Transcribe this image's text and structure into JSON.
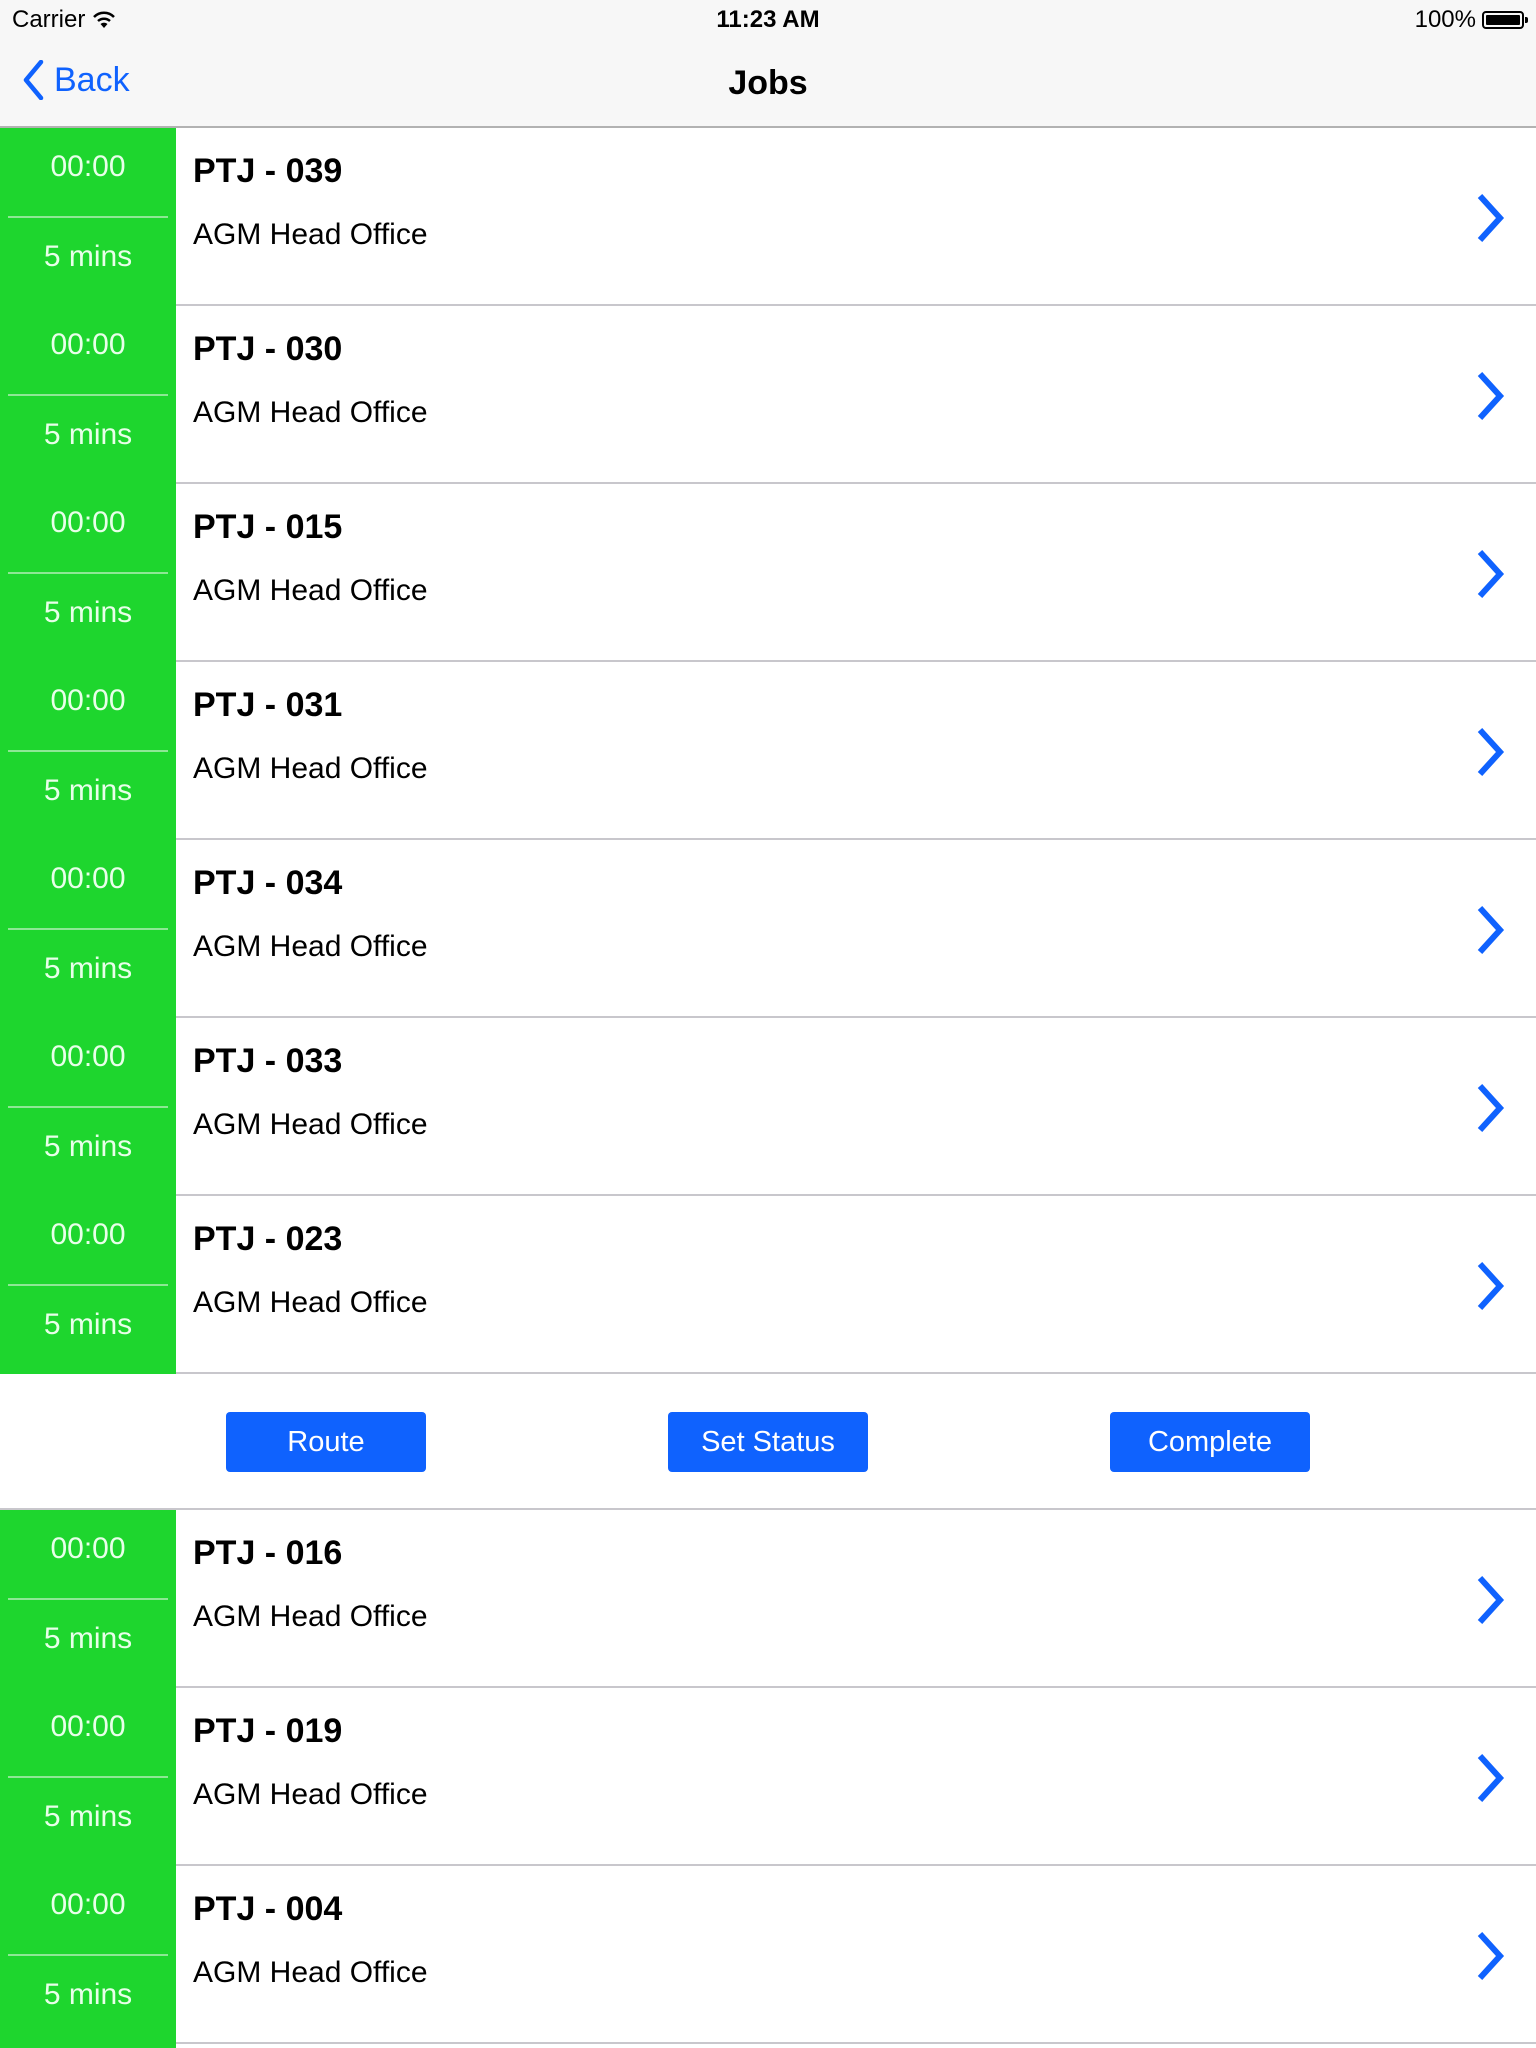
{
  "status_bar": {
    "carrier": "Carrier",
    "time": "11:23 AM",
    "battery": "100%",
    "battery_level": 1.0
  },
  "nav": {
    "back_label": "Back",
    "title": "Jobs"
  },
  "colors": {
    "accent": "#0f62fe",
    "status_green": "#1ed62e"
  },
  "jobs_top": [
    {
      "time": "00:00",
      "duration": "5 mins",
      "code": "PTJ - 039",
      "location": "AGM Head Office"
    },
    {
      "time": "00:00",
      "duration": "5 mins",
      "code": "PTJ - 030",
      "location": "AGM Head Office"
    },
    {
      "time": "00:00",
      "duration": "5 mins",
      "code": "PTJ - 015",
      "location": "AGM Head Office"
    },
    {
      "time": "00:00",
      "duration": "5 mins",
      "code": "PTJ - 031",
      "location": "AGM Head Office"
    },
    {
      "time": "00:00",
      "duration": "5 mins",
      "code": "PTJ - 034",
      "location": "AGM Head Office"
    },
    {
      "time": "00:00",
      "duration": "5 mins",
      "code": "PTJ - 033",
      "location": "AGM Head Office"
    },
    {
      "time": "00:00",
      "duration": "5 mins",
      "code": "PTJ - 023",
      "location": "AGM Head Office"
    }
  ],
  "actions": {
    "route": "Route",
    "set_status": "Set Status",
    "complete": "Complete"
  },
  "jobs_bottom": [
    {
      "time": "00:00",
      "duration": "5 mins",
      "code": "PTJ - 016",
      "location": "AGM Head Office"
    },
    {
      "time": "00:00",
      "duration": "5 mins",
      "code": "PTJ - 019",
      "location": "AGM Head Office"
    },
    {
      "time": "00:00",
      "duration": "5 mins",
      "code": "PTJ - 004",
      "location": "AGM Head Office"
    }
  ]
}
